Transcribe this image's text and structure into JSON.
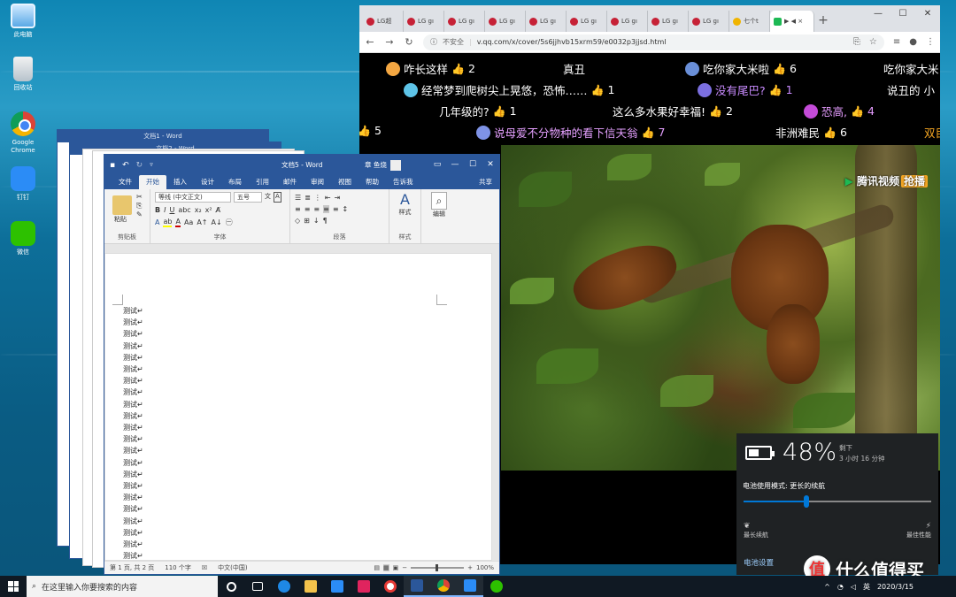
{
  "desktop": {
    "icons": [
      {
        "label": "此电脑",
        "icon": "pc-icon"
      },
      {
        "label": "回收站",
        "icon": "recycle-bin-icon"
      },
      {
        "label": "Google Chrome",
        "icon": "chrome-icon"
      },
      {
        "label": "钉钉",
        "icon": "dingtalk-icon"
      },
      {
        "label": "微信",
        "icon": "wechat-icon"
      }
    ]
  },
  "browser": {
    "tabs": [
      "LG超",
      "LG gı",
      "LG gı",
      "LG gı",
      "LG gı",
      "LG gı",
      "LG gı",
      "LG gı",
      "LG gı",
      "七个t"
    ],
    "active_tab": "▶ ◀ ×",
    "new_tab": "+",
    "url_warning": "不安全",
    "url": "v.qq.com/x/cover/5s6jjhvb15xrm59/e0032p3jjsd.html",
    "danmaku": [
      {
        "text": "咋长这样",
        "likes": "2",
        "avatar": "#f4a742"
      },
      {
        "text": "真丑",
        "likes": ""
      },
      {
        "text": "吃你家大米啦",
        "likes": "6",
        "avatar": "#6a8fd8"
      },
      {
        "text": "吃你家大米",
        "likes": "",
        "clip": true
      },
      {
        "text": "经常梦到爬树尖上晃悠，恐怖……",
        "likes": "1",
        "avatar": "#5ec4e8"
      },
      {
        "text": "没有尾巴?",
        "likes": "1",
        "avatar": "#7b6fe0",
        "color": "#c98bff"
      },
      {
        "text": "说丑的 小",
        "likes": ""
      },
      {
        "text": "几年级的?",
        "likes": "1"
      },
      {
        "text": "这么多水果好幸福!",
        "likes": "2"
      },
      {
        "text": "恐高,",
        "likes": "4",
        "avatar": "#c44bd8",
        "color": "#e59cff"
      },
      {
        "text": "5",
        "likes": "",
        "prefix": true
      },
      {
        "text": "说母爱不分物种的看下信天翁",
        "likes": "7",
        "avatar": "#7f93e6",
        "color": "#e5a0ff"
      },
      {
        "text": "非洲难民",
        "likes": "6"
      },
      {
        "text": "双目",
        "likes": "",
        "color": "#f5a623"
      }
    ],
    "video_logo": "腾讯视频",
    "video_badge": "抢播"
  },
  "word": {
    "back_titles": [
      "文档1 - Word",
      "文档2 - Word"
    ],
    "back_user": "章 鱼烧",
    "title": "文档5 - Word",
    "user": "章 鱼烧",
    "tabs": [
      "文件",
      "开始",
      "插入",
      "设计",
      "布局",
      "引用",
      "邮件",
      "审阅",
      "视图",
      "帮助",
      "告诉我"
    ],
    "share": "共享",
    "font_name": "等线 (中文正文)",
    "font_size": "五号",
    "groups": [
      "剪贴板",
      "字体",
      "段落",
      "样式",
      "编辑"
    ],
    "paste": "粘贴",
    "style_btn": "样式",
    "edit_btn": "编辑",
    "lines": [
      "测试↵",
      "测试↵",
      "测试↵",
      "测试↵",
      "测试↵",
      "测试↵",
      "测试↵",
      "测试↵",
      "测试↵",
      "测试↵",
      "测试↵",
      "测试↵",
      "测试↵",
      "测试↵",
      "测试↵",
      "测试↵",
      "测试↵",
      "测试↵",
      "测试↵",
      "测试↵",
      "测试↵",
      "测试↵"
    ],
    "status": {
      "page": "第 1 页, 共 2 页",
      "words": "110 个字",
      "lang": "中文(中国)",
      "zoom": "100%"
    }
  },
  "battery": {
    "percent": "48%",
    "remaining_label": "剩下",
    "remaining": "3 小时 16 分钟",
    "mode": "电池使用模式: 更长的续航",
    "left": "最长续航",
    "right": "最佳性能",
    "settings": "电池设置",
    "level": 0.48
  },
  "watermark": "什么值得买",
  "watermark_icon": "值",
  "taskbar": {
    "search_placeholder": "在这里输入你要搜索的内容",
    "lang": "英",
    "date": "2020/3/15"
  }
}
